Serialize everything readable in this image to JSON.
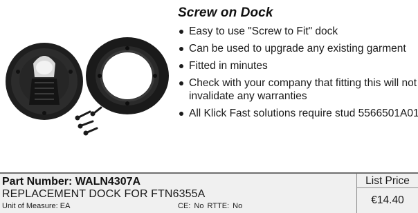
{
  "product": {
    "title": "Screw on Dock",
    "bullets": [
      "Easy to use \"Screw to Fit\" dock",
      "Can be used to upgrade any existing garment",
      "Fitted in minutes",
      "Check with your company that fitting this will not invalidate any warranties",
      "All Klick Fast solutions require stud 5566501A01"
    ]
  },
  "details": {
    "part_number": "Part Number: WALN4307A",
    "description": "REPLACEMENT DOCK FOR FTN6355A",
    "unit_of_measure": "Unit of Measure: EA",
    "flags": "CE: No   RTTE: No"
  },
  "pricing": {
    "label": "List Price",
    "value": "€14.40"
  },
  "image": {
    "icon": "screw-on-dock-product-photo"
  }
}
